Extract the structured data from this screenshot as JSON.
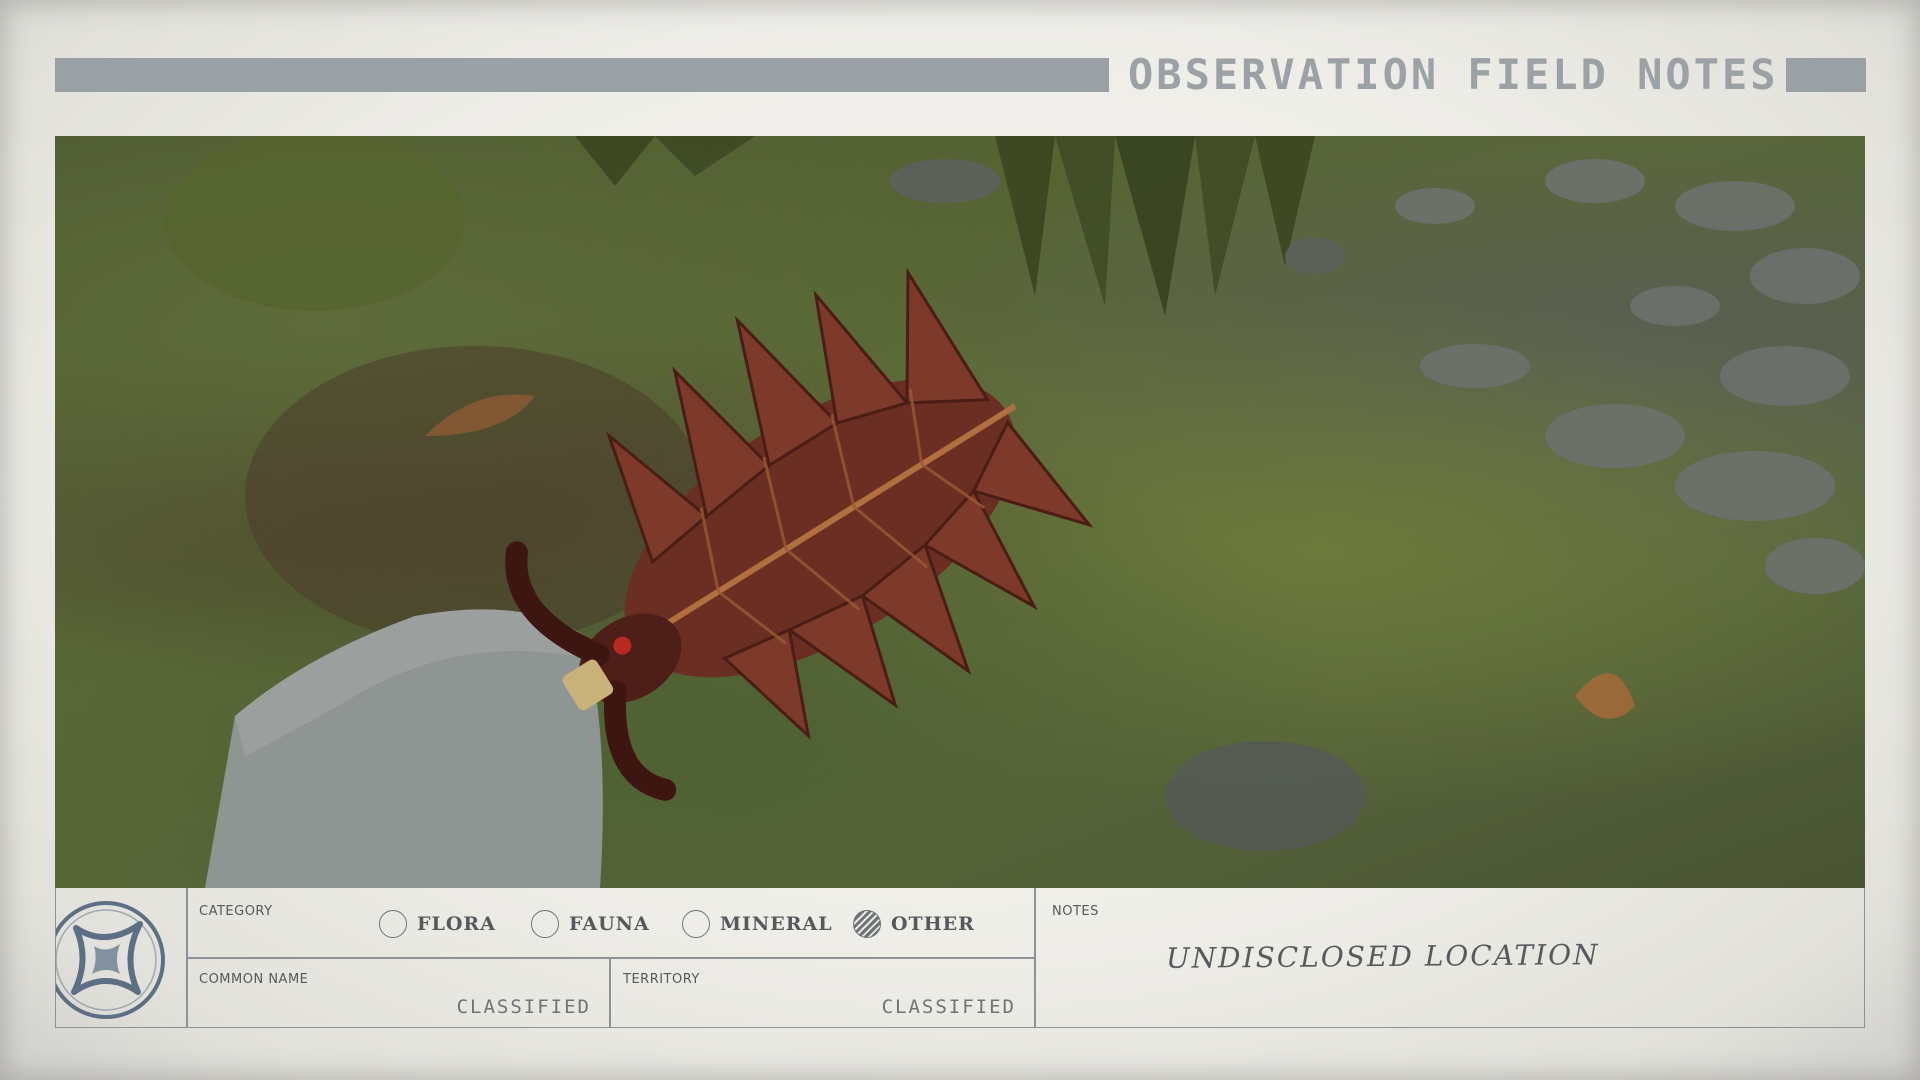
{
  "header": {
    "title": "OBSERVATION FIELD NOTES"
  },
  "photo": {
    "subject": "Red spiked leaf-shaped creature on mossy ground"
  },
  "form": {
    "category": {
      "label": "CATEGORY",
      "options": [
        {
          "label": "FLORA",
          "selected": false
        },
        {
          "label": "FAUNA",
          "selected": false
        },
        {
          "label": "MINERAL",
          "selected": false
        },
        {
          "label": "OTHER",
          "selected": true
        }
      ]
    },
    "common_name": {
      "label": "COMMON NAME",
      "value": "CLASSIFIED"
    },
    "territory": {
      "label": "TERRITORY",
      "value": "CLASSIFIED"
    },
    "notes": {
      "label": "NOTES",
      "value": "UNDISCLOSED LOCATION"
    }
  },
  "logo": {
    "icon": "star-emblem-icon"
  },
  "colors": {
    "paper": "#eeede8",
    "ink": "#55595c",
    "bar": "#9aa0a4",
    "emblem": "#5d6f85"
  }
}
